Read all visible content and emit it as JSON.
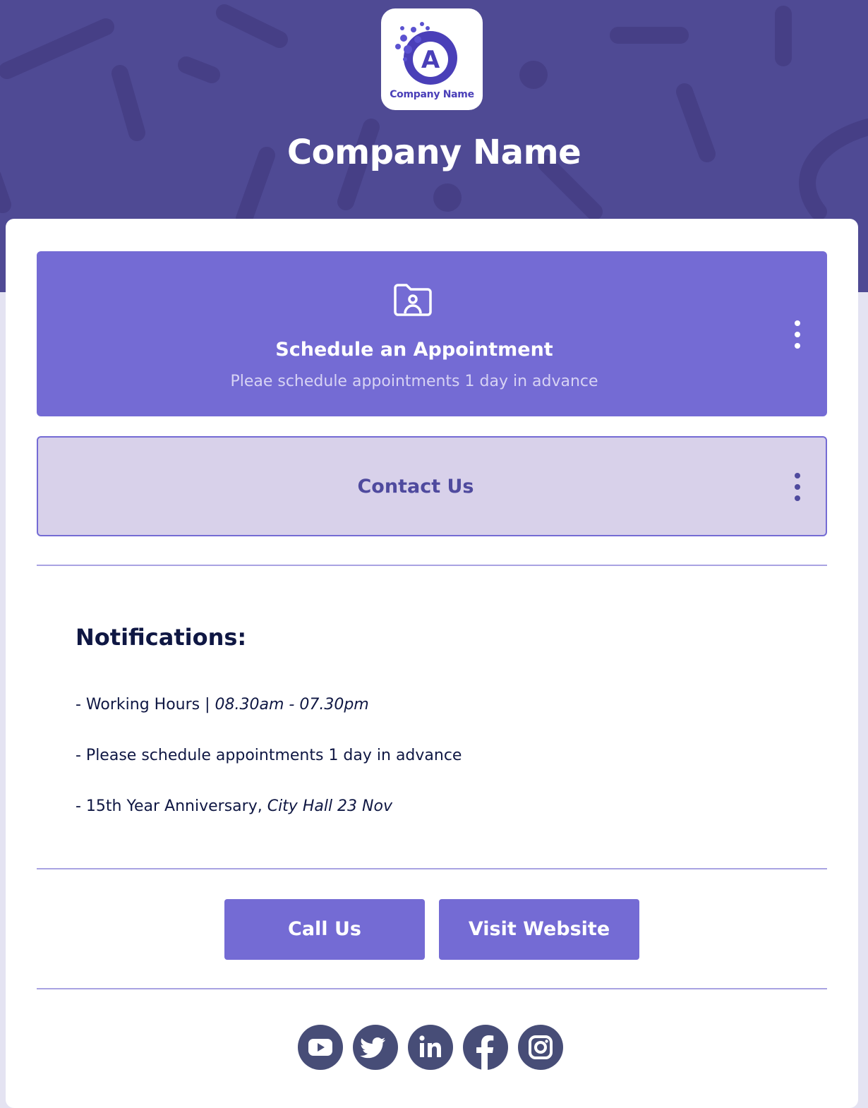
{
  "header": {
    "logo_text": "Company Name",
    "logo_letter": "A",
    "title": "Company Name"
  },
  "tiles": [
    {
      "title": "Schedule an Appointment",
      "subtitle": "Pleae schedule appointments 1 day in advance",
      "icon": "folder-user-icon"
    },
    {
      "title": "Contact Us"
    }
  ],
  "notifications": {
    "heading": "Notifications:",
    "items": [
      {
        "text": "- Working Hours | ",
        "emphasis": "08.30am - 07.30pm"
      },
      {
        "text": "- Please schedule appointments 1 day in advance",
        "emphasis": ""
      },
      {
        "text": "- 15th Year Anniversary, ",
        "emphasis": "City Hall 23 Nov"
      }
    ]
  },
  "buttons": {
    "call": "Call Us",
    "website": "Visit Website"
  },
  "social": [
    "youtube-icon",
    "twitter-icon",
    "linkedin-icon",
    "facebook-icon",
    "instagram-icon"
  ],
  "colors": {
    "header_bg": "#4f4a94",
    "accent": "#746bd4",
    "contact_tile_bg": "#d8d1ea",
    "text_dark": "#0f1743",
    "social_icon_bg": "#474d77"
  }
}
